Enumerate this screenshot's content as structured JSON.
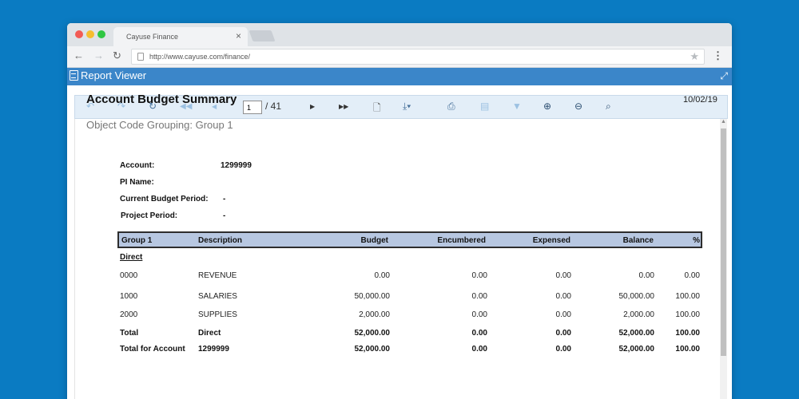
{
  "browser": {
    "tab_title": "Cayuse Finance",
    "tab_close": "×",
    "url": "http://www.cayuse.com/finance/"
  },
  "viewer": {
    "title": "Report Viewer",
    "page_current": "1",
    "page_total": "/ 41"
  },
  "report": {
    "title": "Account Budget Summary",
    "date": "10/02/19",
    "subtitle": "Object Code Grouping: Group 1",
    "info": [
      {
        "label": "Account:",
        "value": "1299999"
      },
      {
        "label": "PI Name:",
        "value": ""
      },
      {
        "label": "Current Budget Period:",
        "value": "-"
      },
      {
        "label": "Project Period:",
        "value": "-"
      }
    ],
    "columns": [
      "Group 1",
      "Description",
      "Budget",
      "Encumbered",
      "Expensed",
      "Balance",
      "%"
    ],
    "group_label": "Direct",
    "rows": [
      [
        "0000",
        "REVENUE",
        "0.00",
        "0.00",
        "0.00",
        "0.00",
        "0.00"
      ],
      [
        "1000",
        "SALARIES",
        "50,000.00",
        "0.00",
        "0.00",
        "50,000.00",
        "100.00"
      ],
      [
        "2000",
        "SUPPLIES",
        "2,000.00",
        "0.00",
        "0.00",
        "2,000.00",
        "100.00"
      ]
    ],
    "total_row": [
      "Total",
      "Direct",
      "52,000.00",
      "0.00",
      "0.00",
      "52,000.00",
      "100.00"
    ],
    "account_total_row": [
      "Total for Account",
      "1299999",
      "52,000.00",
      "0.00",
      "0.00",
      "52,000.00",
      "100.00"
    ]
  },
  "icons": [
    "back-arrow-icon",
    "forward-arrow-icon",
    "reload-icon",
    "first-page-icon",
    "previous-page-icon",
    "next-page-icon",
    "last-page-icon",
    "document-icon",
    "download-icon",
    "print-icon",
    "copy-icon",
    "filter-icon",
    "zoom-in-icon",
    "zoom-out-icon",
    "zoom-fit-icon"
  ],
  "colors": {
    "background": "#0a7bc2",
    "viewer_header": "#3b86c9",
    "table_header": "#b7c7e1"
  }
}
